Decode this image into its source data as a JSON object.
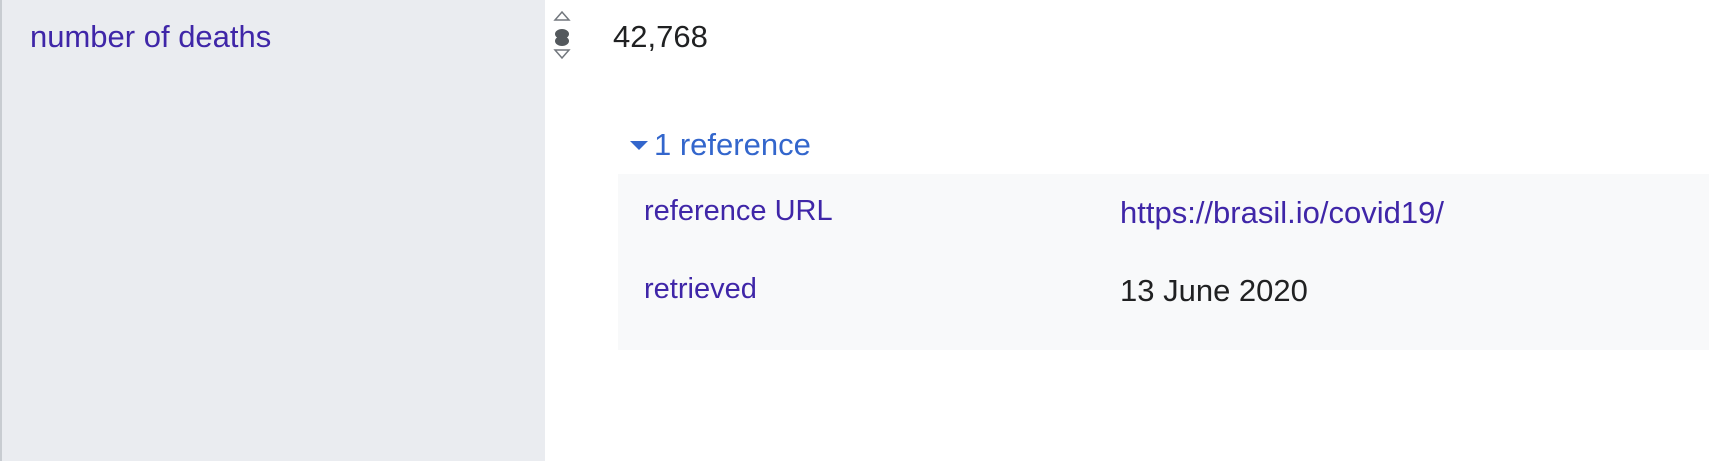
{
  "statement": {
    "property_label": "number of deaths",
    "value": "42,768",
    "rank_icon": "rank-normal-icon"
  },
  "references": {
    "toggle_label": "1 reference",
    "toggle_icon": "expand-triangle-icon",
    "rows": [
      {
        "property": "reference URL",
        "value": "https://brasil.io/covid19/"
      },
      {
        "property": "retrieved",
        "value": "13 June 2020"
      }
    ]
  },
  "colors": {
    "property_bg": "#eaecf0",
    "reference_bg": "#f8f9fa",
    "link": "#3f26a8",
    "accent": "#3366cc",
    "text": "#202122"
  }
}
